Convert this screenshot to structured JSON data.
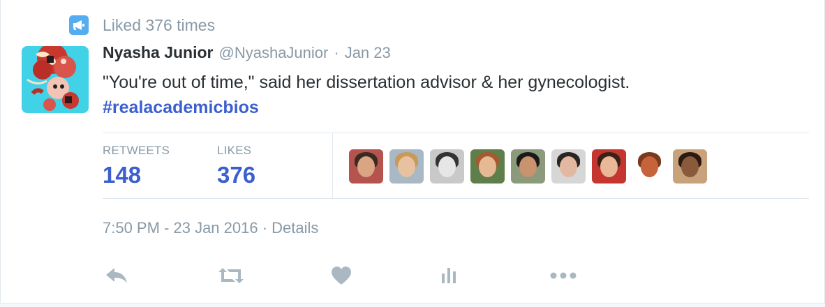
{
  "context": {
    "icon": "megaphone-icon",
    "text": "Liked 376 times"
  },
  "tweet": {
    "author_name": "Nyasha Junior",
    "handle": "@NyashaJunior",
    "separator": "·",
    "date": "Jan 23",
    "text": "\"You're out of time,\" said her dissertation advisor & her gynecologist.",
    "hashtag": "#realacademicbios"
  },
  "stats": {
    "retweets_label": "RETWEETS",
    "retweets_value": "148",
    "likes_label": "LIKES",
    "likes_value": "376"
  },
  "likers": [
    {
      "name": "liker-avatar-1",
      "bg": "#b5544e",
      "hair": "#3a2a22",
      "face": "#d9a583"
    },
    {
      "name": "liker-avatar-2",
      "bg": "#a8b8c4",
      "hair": "#c7995a",
      "face": "#e8c2a0"
    },
    {
      "name": "liker-avatar-3",
      "bg": "#c9c9c9",
      "hair": "#333333",
      "face": "#e6e6e6"
    },
    {
      "name": "liker-avatar-4",
      "bg": "#5f7f4a",
      "hair": "#a55a30",
      "face": "#e6b894"
    },
    {
      "name": "liker-avatar-5",
      "bg": "#8a9a7a",
      "hair": "#1c1a18",
      "face": "#c99370"
    },
    {
      "name": "liker-avatar-6",
      "bg": "#d6d6d6",
      "hair": "#2a2523",
      "face": "#e2b9a0"
    },
    {
      "name": "liker-avatar-7",
      "bg": "#c4362f",
      "hair": "#3b2116",
      "face": "#e8b898"
    },
    {
      "name": "liker-avatar-8",
      "bg": "#ffffff",
      "hair": "#7a3a1c",
      "face": "#c6633a"
    },
    {
      "name": "liker-avatar-9",
      "bg": "#c7a27a",
      "hair": "#2a1a12",
      "face": "#8a5a3c"
    }
  ],
  "timestamp": {
    "time": "7:50 PM - 23 Jan 2016",
    "separator": "·",
    "details_link": "Details"
  },
  "actions": {
    "reply": "reply-icon",
    "retweet": "retweet-icon",
    "like": "heart-icon",
    "analytics": "analytics-icon",
    "more": "more-icon"
  },
  "colors": {
    "accent": "#55acee",
    "link": "#3b5fcf",
    "muted": "#8899a6",
    "icon": "#aab8c2"
  }
}
